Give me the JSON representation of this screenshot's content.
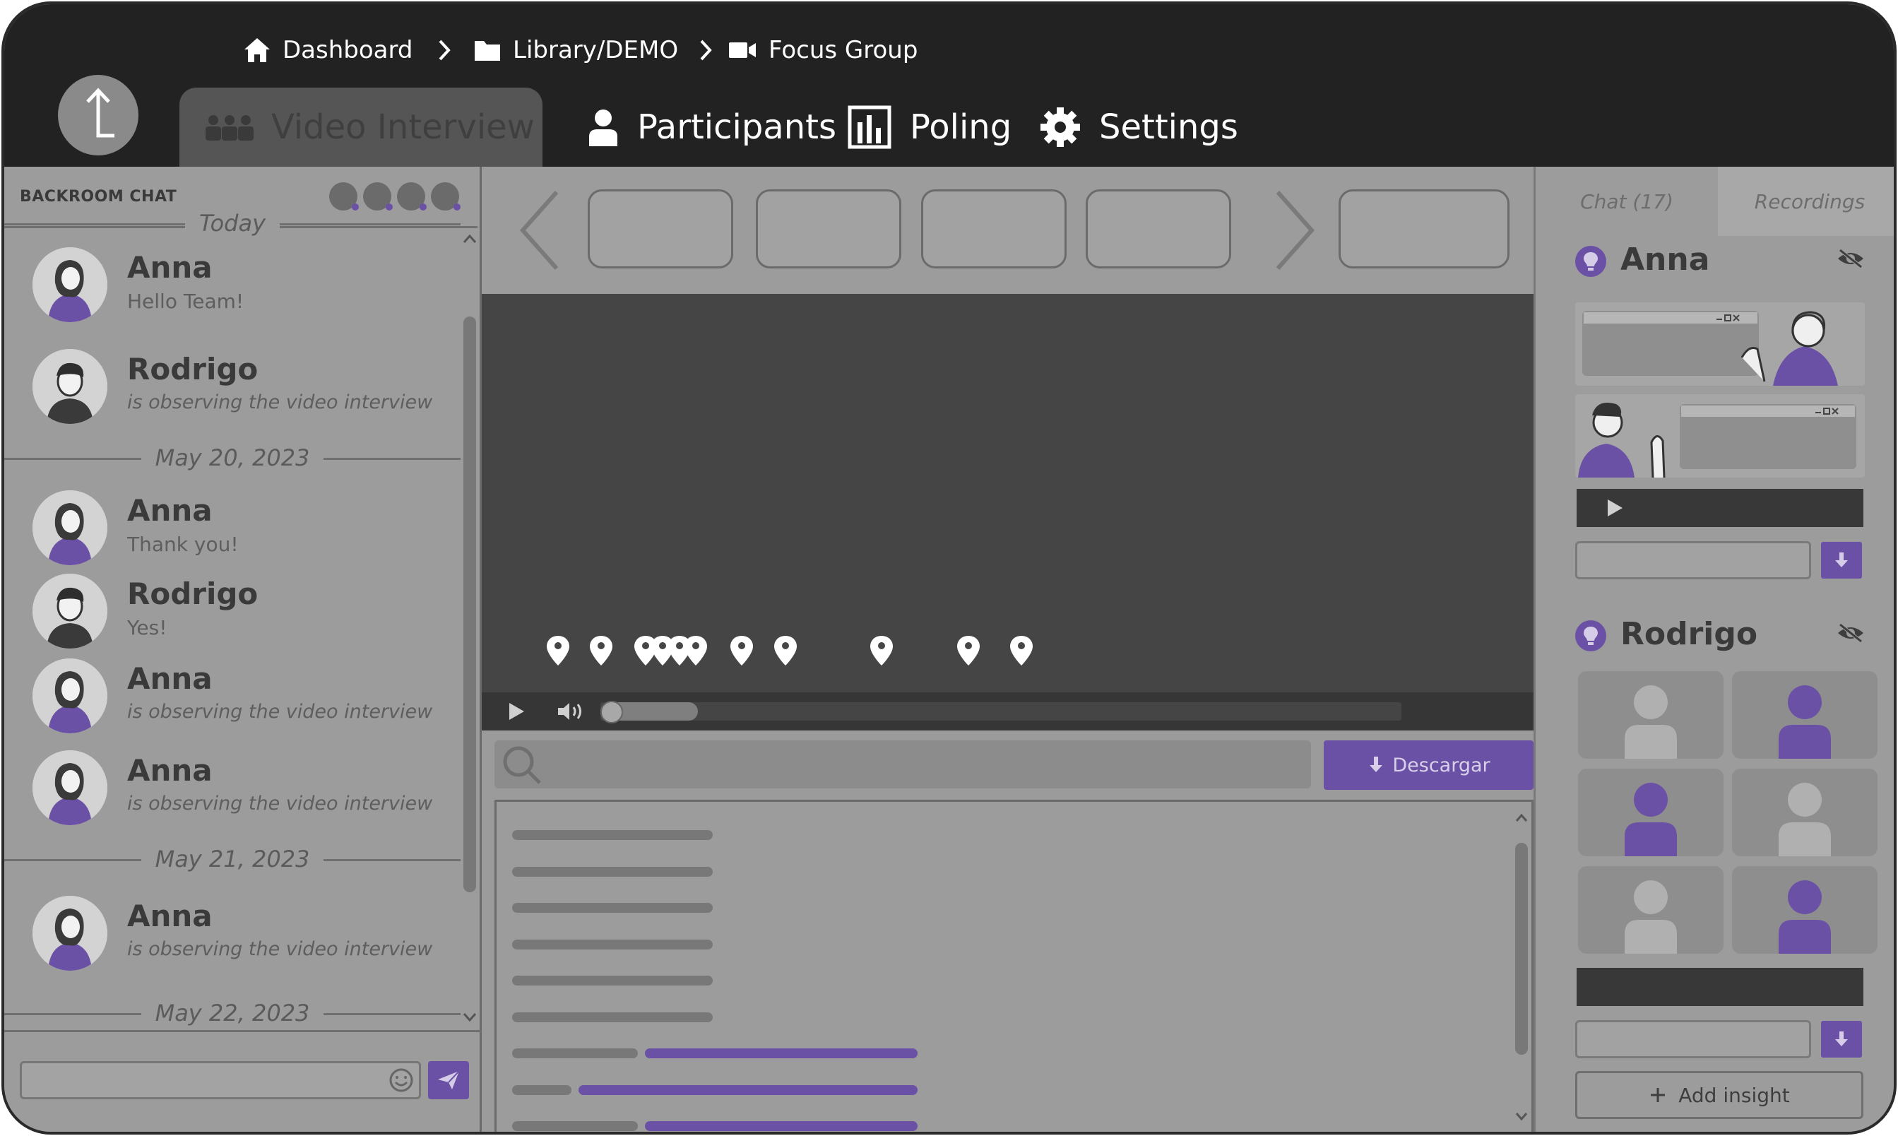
{
  "breadcrumb": {
    "items": [
      {
        "label": "Dashboard",
        "icon": "home-icon"
      },
      {
        "label": "Library/DEMO",
        "icon": "folder-icon"
      },
      {
        "label": "Focus Group",
        "icon": "video-camera-icon"
      }
    ]
  },
  "nav": {
    "active_tab": "Video Interview",
    "tabs": [
      {
        "label": "Participants",
        "icon": "person-icon"
      },
      {
        "label": "Poling",
        "icon": "bar-chart-icon"
      },
      {
        "label": "Settings",
        "icon": "gear-icon"
      }
    ]
  },
  "backroom": {
    "title": "BACKROOM CHAT",
    "groups": [
      {
        "date": "Today",
        "messages": [
          {
            "name": "Anna",
            "text": "Hello Team!",
            "italic": false
          },
          {
            "name": "Rodrigo",
            "text": "is observing the video interview",
            "italic": true
          }
        ]
      },
      {
        "date": "May 20, 2023",
        "messages": [
          {
            "name": "Anna",
            "text": "Thank you!",
            "italic": false
          },
          {
            "name": "Rodrigo",
            "text": "Yes!",
            "italic": false
          },
          {
            "name": "Anna",
            "text": "is observing the video interview",
            "italic": true
          },
          {
            "name": "Anna",
            "text": "is observing the video interview",
            "italic": true
          }
        ]
      },
      {
        "date": "May 21, 2023",
        "messages": [
          {
            "name": "Anna",
            "text": "is observing the video interview",
            "italic": true
          }
        ]
      },
      {
        "date": "May 22, 2023",
        "messages": []
      }
    ]
  },
  "player": {
    "download_label": "Descargar"
  },
  "right_panel": {
    "tabs": [
      "Chat (17)",
      "Recordings"
    ],
    "sections": [
      {
        "name": "Anna"
      },
      {
        "name": "Rodrigo"
      }
    ],
    "add_insight_label": "Add insight"
  },
  "colors": {
    "accent": "#6b51a6",
    "topbar": "#222222",
    "panel": "#9c9c9c",
    "video": "#454545"
  }
}
